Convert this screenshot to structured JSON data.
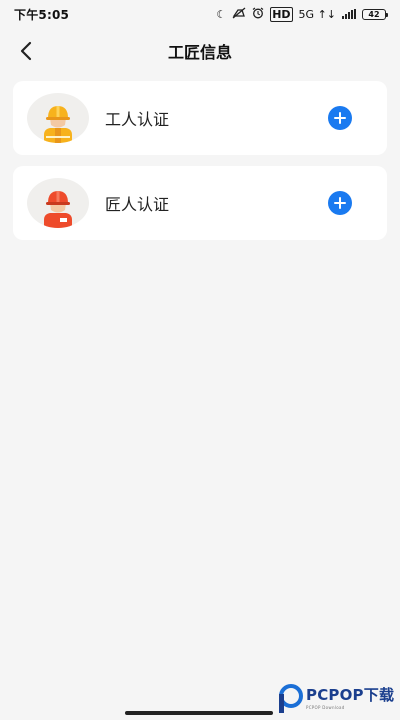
{
  "status_bar": {
    "time": "下午5:05",
    "network": "5G",
    "hd": "HD",
    "battery": "42",
    "icons": [
      "moon-icon",
      "mute-icon",
      "alarm-icon",
      "hd-icon",
      "5g-icon",
      "signal-icon",
      "battery-icon"
    ]
  },
  "nav": {
    "title": "工匠信息",
    "back_icon": "chevron-left-icon"
  },
  "cards": [
    {
      "label": "工人认证",
      "avatar": "worker-yellow-helmet-avatar",
      "action_icon": "plus-circle-icon"
    },
    {
      "label": "匠人认证",
      "avatar": "craftsman-red-helmet-avatar",
      "action_icon": "plus-circle-icon"
    }
  ],
  "watermark": {
    "brand": "PCPOP下载",
    "sub": "PCPOP Download"
  },
  "colors": {
    "accent": "#1a7af0",
    "background": "#f5f5f5",
    "card": "#ffffff",
    "worker_helmet": "#f7b21c",
    "craftsman_helmet": "#ee4b2b"
  }
}
